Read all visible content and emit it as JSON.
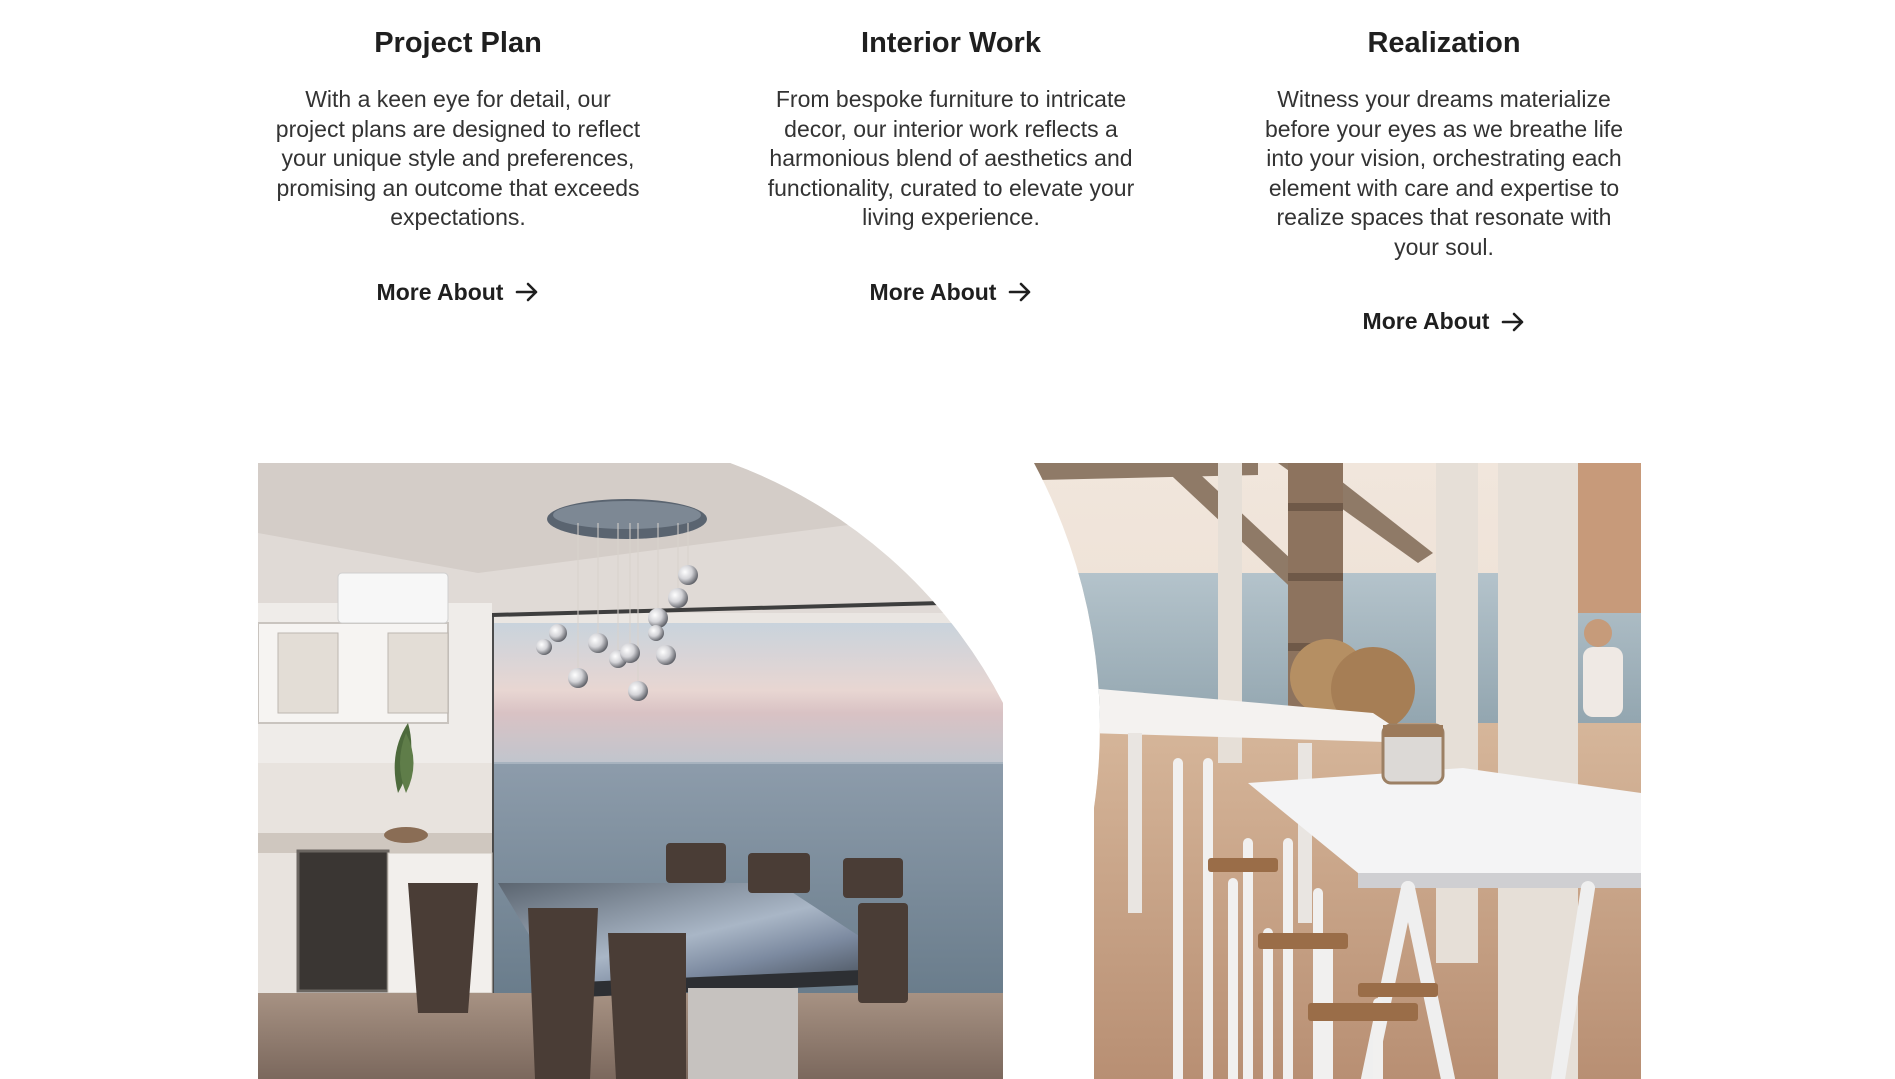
{
  "features": [
    {
      "title": "Project Plan",
      "text": "With a keen eye for detail, our project plans are designed to reflect your unique style and preferences, promising an outcome that exceeds expectations.",
      "link": "More About"
    },
    {
      "title": "Interior Work",
      "text": "From bespoke furniture to intricate decor, our interior work reflects a harmonious blend of aesthetics and functionality, curated to elevate your living experience.",
      "link": "More About"
    },
    {
      "title": "Realization",
      "text": "Witness your dreams materialize before your eyes as we breathe life into your vision, orchestrating each element with care and expertise to realize spaces that resonate with your soul.",
      "link": "More About"
    }
  ],
  "images": {
    "left": "dining-room-ocean-view-photo",
    "right": "seaside-terrace-tables-photo"
  },
  "icons": {
    "link_arrow": "arrow-right-icon"
  },
  "colors": {
    "text": "#222222",
    "background": "#ffffff"
  }
}
